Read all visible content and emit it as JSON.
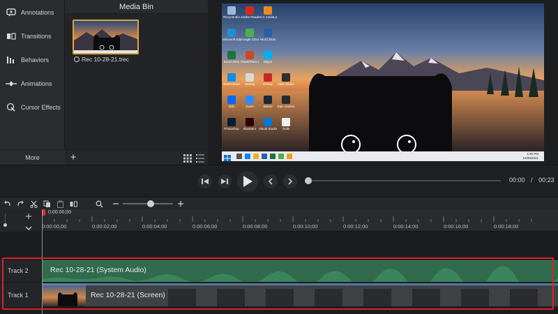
{
  "tools": {
    "items": [
      {
        "label": "Annotations",
        "icon": "annotations-icon"
      },
      {
        "label": "Transitions",
        "icon": "transitions-icon"
      },
      {
        "label": "Behaviors",
        "icon": "behaviors-icon"
      },
      {
        "label": "Animations",
        "icon": "animations-icon"
      },
      {
        "label": "Cursor Effects",
        "icon": "cursor-effects-icon"
      }
    ],
    "more_label": "More"
  },
  "media_bin": {
    "title": "Media Bin",
    "clip_name": "Rec 10-28-21.trec"
  },
  "desktop": {
    "icons": [
      "Recycle Bin",
      "Adobe Reader",
      "VLC media player",
      "Microsoft Edge",
      "Google Chrome",
      "Word 2016",
      "Excel 2016",
      "PowerPoint 2016",
      "Skype",
      "TeamViewer",
      "UniKey",
      "EVKey",
      "OBS Studio",
      "Zalo",
      "Zoom",
      "Steam",
      "Epic Games",
      "Photoshop",
      "Illustrator",
      "Visual Studio",
      "Tools"
    ],
    "clock_time": "4:35 PM",
    "clock_date": "10/28/2021"
  },
  "playback": {
    "current_time": "00:00",
    "separator": "/",
    "total_time": "00:23",
    "progress": 0.0
  },
  "timeline": {
    "playhead_time": "0:00:00;00",
    "ruler_ticks": [
      "0:00:00;00",
      "0:00:02;00",
      "0:00:04;00",
      "0:00:06;00",
      "0:00:08;00",
      "0:00:10;00",
      "0:00:12;00",
      "0:00:14;00",
      "0:00:16;00",
      "0:00:18;00"
    ],
    "zoom_level": 0.55,
    "tracks": [
      {
        "name": "Track 2",
        "clip": "Rec 10-28-21 (System Audio)"
      },
      {
        "name": "Track 1",
        "clip": "Rec 10-28-21 (Screen)"
      }
    ]
  },
  "colors": {
    "accent": "#e0a43a",
    "audio_clip": "#2f6b4c",
    "highlight": "#e0202a",
    "playhead": "#d33333"
  }
}
